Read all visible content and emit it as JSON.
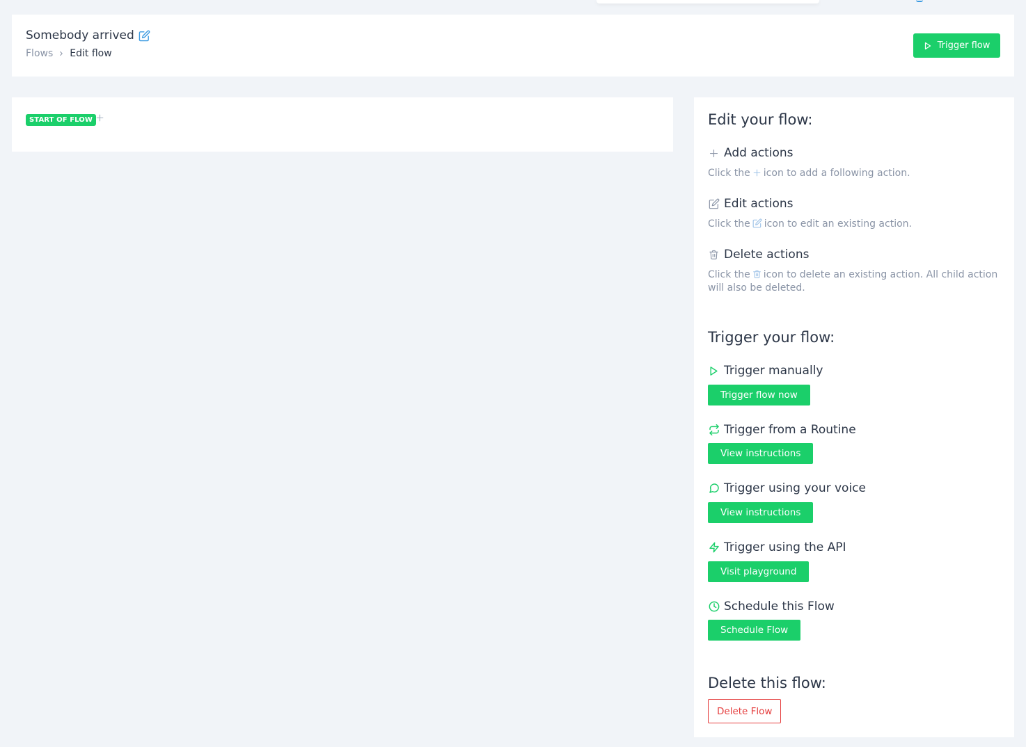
{
  "header": {
    "flow_title": "Somebody arrived",
    "breadcrumb": {
      "parent": "Flows",
      "current": "Edit flow"
    },
    "trigger_button": "Trigger flow"
  },
  "canvas": {
    "start_badge": "START OF FLOW"
  },
  "sidebar": {
    "edit_heading": "Edit your flow:",
    "add_actions": {
      "title": "Add actions",
      "desc_before": "Click the",
      "desc_after": "icon to add a following action."
    },
    "edit_actions": {
      "title": "Edit actions",
      "desc_before": "Click the",
      "desc_after": "icon to edit an existing action."
    },
    "delete_actions": {
      "title": "Delete actions",
      "desc_before": "Click the",
      "desc_after": "icon to delete an existing action. All child action will also be deleted."
    },
    "trigger_heading": "Trigger your flow:",
    "trigger_manually": {
      "title": "Trigger manually",
      "button": "Trigger flow now"
    },
    "trigger_routine": {
      "title": "Trigger from a Routine",
      "button": "View instructions"
    },
    "trigger_voice": {
      "title": "Trigger using your voice",
      "button": "View instructions"
    },
    "trigger_api": {
      "title": "Trigger using the API",
      "button": "Visit playground"
    },
    "schedule": {
      "title": "Schedule this Flow",
      "button": "Schedule Flow"
    },
    "delete_heading": "Delete this flow:",
    "delete_button": "Delete Flow"
  },
  "colors": {
    "accent_green": "#1bcf6a",
    "edit_blue": "#3b9ae1",
    "danger_red": "#e53e3e",
    "muted_text": "#8a94a6",
    "page_bg": "#f1f4f8"
  },
  "icons": {
    "title_edit": "edit-icon",
    "breadcrumb_sep": "chevron-right-icon",
    "trigger": "play-icon",
    "add": "plus-icon",
    "edit": "edit-icon",
    "delete": "trash-icon",
    "routine": "repeat-icon",
    "voice": "chat-bubble-icon",
    "api": "lightning-icon",
    "schedule": "clock-icon"
  }
}
